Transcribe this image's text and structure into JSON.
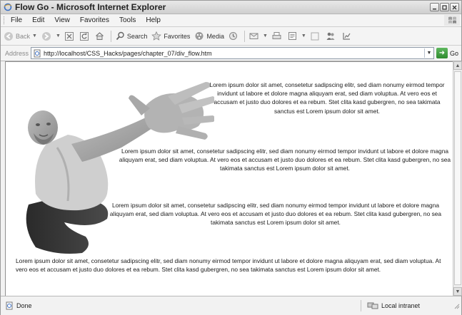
{
  "window": {
    "title": "Flow Go - Microsoft Internet Explorer",
    "buttons": [
      "minimize",
      "maximize",
      "close"
    ]
  },
  "menubar": {
    "items": [
      "File",
      "Edit",
      "View",
      "Favorites",
      "Tools",
      "Help"
    ]
  },
  "toolbar": {
    "back_label": "Back",
    "search_label": "Search",
    "favorites_label": "Favorites",
    "media_label": "Media"
  },
  "addressbar": {
    "label": "Address",
    "url": "http://localhost/CSS_Hacks/pages/chapter_07/div_flow.htm",
    "go_label": "Go"
  },
  "content": {
    "paragraphs": [
      "Lorem ipsum dolor sit amet, consetetur sadipscing elitr, sed diam nonumy eirmod tempor invidunt ut labore et dolore magna aliquyam erat, sed diam voluptua. At vero eos et accusam et justo duo dolores et ea rebum. Stet clita kasd gubergren, no sea takimata sanctus est Lorem ipsum dolor sit amet.",
      "Lorem ipsum dolor sit amet, consetetur sadipscing elitr, sed diam nonumy eirmod tempor invidunt ut labore et dolore magna aliquyam erat, sed diam voluptua. At vero eos et accusam et justo duo dolores et ea rebum. Stet clita kasd gubergren, no sea takimata sanctus est Lorem ipsum dolor sit amet.",
      "Lorem ipsum dolor sit amet, consetetur sadipscing elitr, sed diam nonumy eirmod tempor invidunt ut labore et dolore magna aliquyam erat, sed diam voluptua. At vero eos et accusam et justo duo dolores et ea rebum. Stet clita kasd gubergren, no sea takimata sanctus est Lorem ipsum dolor sit amet.",
      "Lorem ipsum dolor sit amet, consetetur sadipscing elitr, sed diam nonumy eirmod tempor invidunt ut labore et dolore magna aliquyam erat, sed diam voluptua. At vero eos et accusam et justo duo dolores et ea rebum. Stet clita kasd gubergren, no sea takimata sanctus est Lorem ipsum dolor sit amet."
    ]
  },
  "statusbar": {
    "status": "Done",
    "zone": "Local intranet"
  }
}
